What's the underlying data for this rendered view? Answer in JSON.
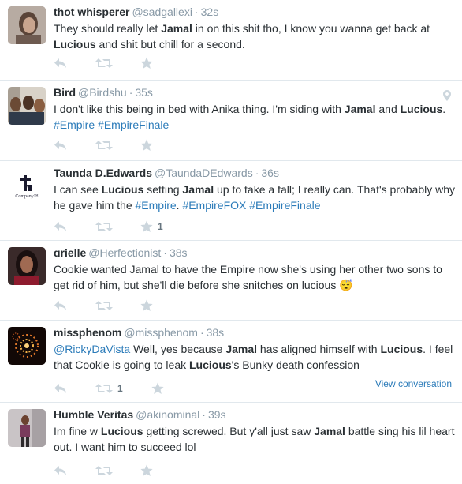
{
  "tweets": [
    {
      "fullname": "thot whisperer",
      "username": "@sadgallexi",
      "time": "32s",
      "text": [
        {
          "t": "They should really let ",
          "b": false
        },
        {
          "t": "Jamal",
          "b": true
        },
        {
          "t": " in on this shit tho, I know you wanna get back at ",
          "b": false
        },
        {
          "t": "Lucious",
          "b": true
        },
        {
          "t": " and shit but chill for a second.",
          "b": false
        }
      ]
    },
    {
      "fullname": "Bird",
      "username": "@Birdshu",
      "time": "35s",
      "text": [
        {
          "t": "I don't like this being in bed with Anika thing. I'm siding with ",
          "b": false
        },
        {
          "t": "Jamal",
          "b": true
        },
        {
          "t": " and ",
          "b": false
        },
        {
          "t": "Lucious",
          "b": true
        },
        {
          "t": ". ",
          "b": false
        },
        {
          "t": "#Empire",
          "h": true
        },
        {
          "t": " ",
          "b": false
        },
        {
          "t": "#EmpireFinale",
          "h": true
        }
      ]
    },
    {
      "fullname": "Taunda D.Edwards",
      "username": "@TaundaDEdwards",
      "time": "36s",
      "avatar_text": "Company™",
      "favorite_count": "1",
      "text": [
        {
          "t": "I can see ",
          "b": false
        },
        {
          "t": "Lucious",
          "b": true
        },
        {
          "t": " setting ",
          "b": false
        },
        {
          "t": "Jamal",
          "b": true
        },
        {
          "t": " up to take a fall; I really can. That's probably why he gave him the ",
          "b": false
        },
        {
          "t": "#Empire",
          "h": true
        },
        {
          "t": ". ",
          "b": false
        },
        {
          "t": "#EmpireFOX",
          "h": true
        },
        {
          "t": " ",
          "b": false
        },
        {
          "t": "#EmpireFinale",
          "h": true
        }
      ]
    },
    {
      "fullname": "ɑrielle",
      "username": "@Herfectionist",
      "time": "38s",
      "text": [
        {
          "t": "Cookie wanted Jamal to have the Empire now she's using her other two sons to get rid of him, but she'll die before she snitches on lucious 😴",
          "b": false
        }
      ]
    },
    {
      "fullname": "missphenom",
      "username": "@missphenom",
      "time": "38s",
      "retweet_count": "1",
      "view_conversation": "View conversation",
      "text": [
        {
          "t": "@RickyDaVista",
          "h": true
        },
        {
          "t": " Well, yes because ",
          "b": false
        },
        {
          "t": "Jamal",
          "b": true
        },
        {
          "t": " has aligned himself with ",
          "b": false
        },
        {
          "t": "Lucious",
          "b": true
        },
        {
          "t": ". I feel that Cookie is going to leak ",
          "b": false
        },
        {
          "t": "Lucious",
          "b": true
        },
        {
          "t": "'s Bunky death confession",
          "b": false
        }
      ]
    },
    {
      "fullname": "Humble Veritas",
      "username": "@akinominal",
      "time": "39s",
      "text": [
        {
          "t": "Im fine w ",
          "b": false
        },
        {
          "t": "Lucious",
          "b": true
        },
        {
          "t": " getting screwed. But y'all just saw ",
          "b": false
        },
        {
          "t": "Jamal",
          "b": true
        },
        {
          "t": " battle sing his lil heart out. I want him to succeed lol",
          "b": false
        }
      ]
    }
  ],
  "colors": {
    "link": "#2b7bb9",
    "name": "#292f33",
    "meta": "#8899a6",
    "icon": "#ccd6dd",
    "divider": "#e1e8ed"
  },
  "icons": [
    "reply-icon",
    "retweet-icon",
    "favorite-icon",
    "location-pin-icon"
  ]
}
